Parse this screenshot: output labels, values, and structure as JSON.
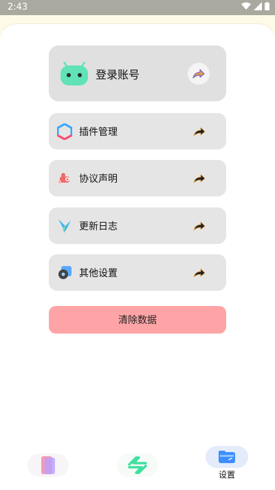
{
  "status_bar": {
    "time": "2:43"
  },
  "login": {
    "label": "登录账号"
  },
  "menu": [
    {
      "label": "插件管理",
      "icon": "hexagon-plugin-icon"
    },
    {
      "label": "协议声明",
      "icon": "agreement-icon"
    },
    {
      "label": "更新日志",
      "icon": "update-bird-icon"
    },
    {
      "label": "其他设置",
      "icon": "settings-gear-icon"
    }
  ],
  "clear_button": {
    "label": "清除数据"
  },
  "bottom_nav": {
    "settings_label": "设置"
  },
  "colors": {
    "accent_green": "#5fe3b7",
    "clear_button": "#ffa4a6",
    "card": "#e5e5e5"
  }
}
